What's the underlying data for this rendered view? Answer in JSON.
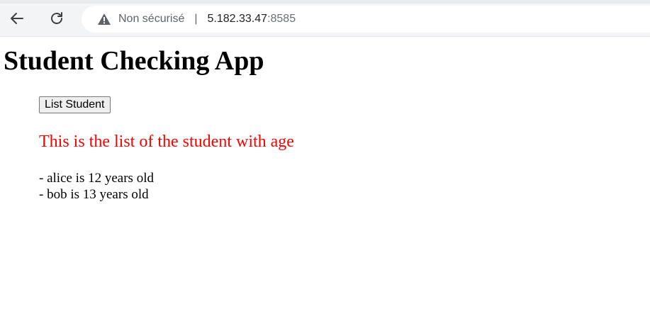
{
  "browser": {
    "security_label": "Non sécurisé",
    "separator": "|",
    "url_host": "5.182.33.47",
    "url_port": ":8585",
    "icons": {
      "back": "back-arrow-icon",
      "reload": "reload-icon",
      "security": "warning-triangle-icon"
    }
  },
  "page": {
    "title": "Student Checking App",
    "list_button_label": "List Student",
    "list_heading": "This is the list of the student with age",
    "students": [
      "- alice is 12 years old",
      "- bob is 13 years old"
    ],
    "colors": {
      "heading_accent": "#ff0000"
    }
  }
}
